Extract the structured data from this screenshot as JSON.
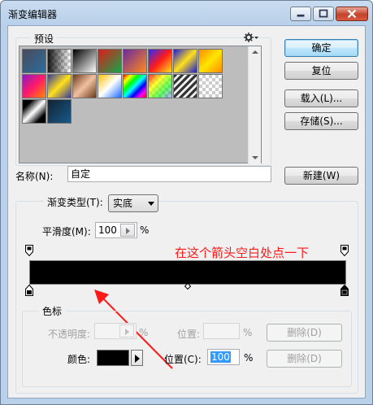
{
  "window": {
    "title": "渐变编辑器"
  },
  "presets": {
    "label": "预设"
  },
  "buttons": {
    "ok": "确定",
    "reset": "复位",
    "load": "载入(L)...",
    "save": "存储(S)...",
    "new": "新建(W)",
    "delete_opacity": "删除(D)",
    "delete_color": "删除(D)"
  },
  "name": {
    "label": "名称(N):",
    "value": "自定"
  },
  "gradient": {
    "type_label": "渐变类型(T):",
    "type_value": "实底",
    "smoothness_label": "平滑度(M):",
    "smoothness_value": "100",
    "percent": "%"
  },
  "annotation": {
    "text": "在这个箭头空白处点一下",
    "color": "#ff1a1a"
  },
  "stops": {
    "group_label": "色标",
    "opacity_label": "不透明度:",
    "opacity_value": "",
    "opacity_percent": "%",
    "opacity_location_label": "位置:",
    "opacity_location_value": "",
    "opacity_location_percent": "%",
    "color_label": "颜色:",
    "color_value": "#000000",
    "location_label": "位置(C):",
    "location_value": "100",
    "location_percent": "%"
  }
}
